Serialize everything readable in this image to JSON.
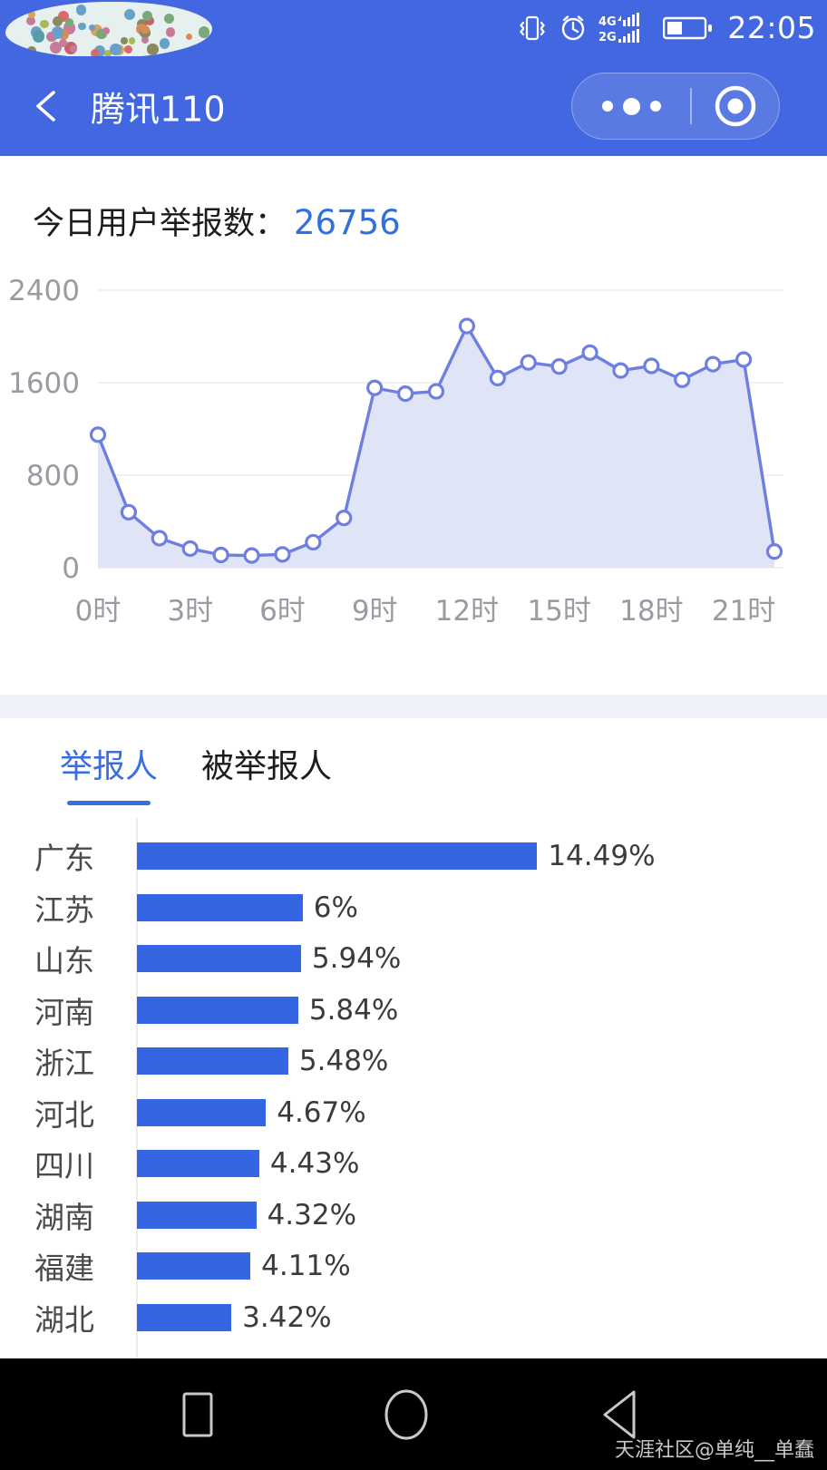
{
  "status_bar": {
    "time": "22:05",
    "icons": [
      "vibrate-icon",
      "alarm-clock-icon",
      "signal-4g-2g-icon",
      "battery-icon"
    ],
    "background_color": "#4267e0"
  },
  "nav_bar": {
    "back_icon": "chevron-left-icon",
    "title": "腾讯110",
    "capsule": {
      "more_icon": "ellipsis-icon",
      "close_icon": "target-circle-icon"
    }
  },
  "summary": {
    "label": "今日用户举报数：",
    "value": "26756",
    "value_color": "#2f6fe0"
  },
  "tabs": [
    {
      "label": "举报人",
      "active": true
    },
    {
      "label": "被举报人",
      "active": false
    }
  ],
  "watermark": "天涯社区@单纯__单蠢",
  "android_nav": {
    "recents_icon": "square-icon",
    "home_icon": "circle-icon",
    "back_icon": "triangle-back-icon"
  },
  "chart_data": [
    {
      "type": "area",
      "title": "今日用户举报数",
      "xlabel": "",
      "ylabel": "",
      "grid": true,
      "legend": "none",
      "line_color": "#6f7fe0",
      "area_color": "#e0e4f7",
      "ylim": [
        0,
        2400
      ],
      "yticks": [
        0,
        800,
        1600,
        2400
      ],
      "ytick_labels": [
        "0",
        "800",
        "1600",
        "2400"
      ],
      "x": [
        "0时",
        "1时",
        "2时",
        "3时",
        "4时",
        "5时",
        "6时",
        "7时",
        "8时",
        "9时",
        "10时",
        "11时",
        "12时",
        "13时",
        "14时",
        "15时",
        "16时",
        "17时",
        "18时",
        "19时",
        "20时",
        "21时",
        "22时"
      ],
      "xtick_labels": [
        "0时",
        "3时",
        "6时",
        "9时",
        "12时",
        "15时",
        "18时",
        "21时"
      ],
      "xtick_indices": [
        0,
        3,
        6,
        9,
        12,
        15,
        18,
        21
      ],
      "values": [
        1150,
        480,
        255,
        165,
        110,
        105,
        115,
        220,
        430,
        1555,
        1505,
        1525,
        2090,
        1640,
        1775,
        1740,
        1860,
        1705,
        1745,
        1625,
        1760,
        1800,
        140
      ]
    },
    {
      "type": "bar",
      "orientation": "horizontal",
      "title": "举报人",
      "bar_color": "#3466e3",
      "categories": [
        "广东",
        "江苏",
        "山东",
        "河南",
        "浙江",
        "河北",
        "四川",
        "湖南",
        "福建",
        "湖北"
      ],
      "values": [
        14.49,
        6,
        5.94,
        5.84,
        5.48,
        4.67,
        4.43,
        4.32,
        4.11,
        3.42
      ],
      "labels": [
        "14.49%",
        "6%",
        "5.94%",
        "5.84%",
        "5.48%",
        "4.67%",
        "4.43%",
        "4.32%",
        "4.11%",
        "3.42%"
      ],
      "xlim": [
        0,
        15.3
      ]
    }
  ]
}
